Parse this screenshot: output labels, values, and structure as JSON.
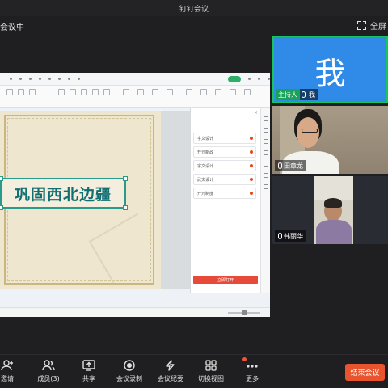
{
  "window": {
    "title": "钉钉会议"
  },
  "meeting": {
    "state": "会议中",
    "fullscreen_label": "全屏"
  },
  "shared_screen": {
    "slide_title": "巩固西北边疆",
    "panel": {
      "items": [
        "字文设计",
        "开元新政",
        "字文设计",
        "武文设计",
        "开元制度"
      ],
      "button_label": "立即打开"
    }
  },
  "participants": {
    "me": {
      "avatar_text": "我",
      "host_badge": "主持人",
      "name": "我"
    },
    "others": [
      {
        "name": "田章龙"
      },
      {
        "name": "韩丽华"
      }
    ]
  },
  "toolbar": {
    "items": [
      {
        "label": "邀请",
        "icon": "invite-icon"
      },
      {
        "label": "成员(3)",
        "icon": "members-icon"
      },
      {
        "label": "共享",
        "icon": "share-icon"
      },
      {
        "label": "会议录制",
        "icon": "record-icon"
      },
      {
        "label": "会议纪要",
        "icon": "notes-icon"
      },
      {
        "label": "切换视图",
        "icon": "grid-icon"
      },
      {
        "label": "更多",
        "icon": "more-icon"
      }
    ],
    "end_label": "结束会议"
  },
  "colors": {
    "accent": "#2f8be7",
    "host_green": "#19a25a",
    "end_red": "#e8542e",
    "slide_text": "#116e73"
  }
}
